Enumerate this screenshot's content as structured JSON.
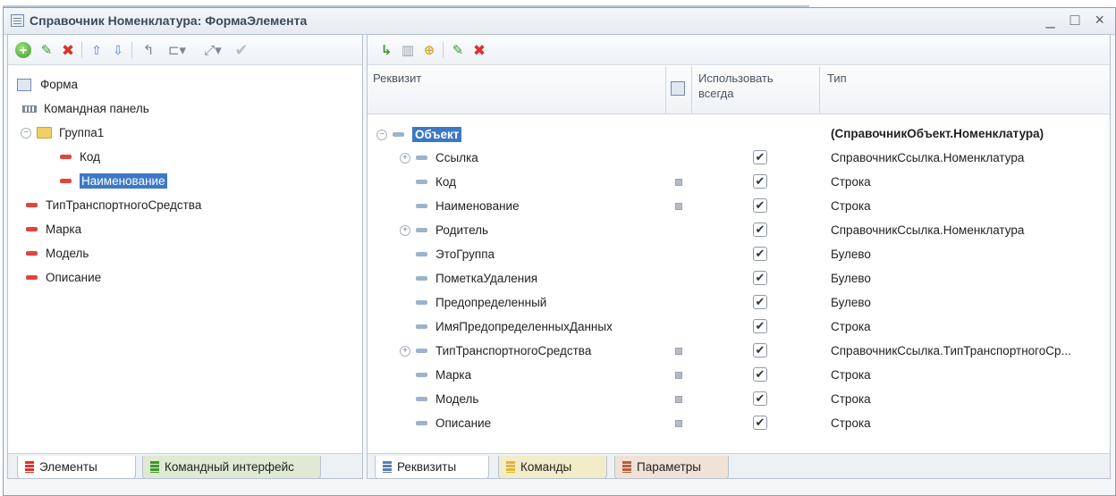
{
  "window": {
    "title": "Справочник Номенклатура: ФормаЭлемента",
    "controls": "_ □ ×"
  },
  "left": {
    "tree": [
      {
        "label": "Форма",
        "icon": "form-icon",
        "level": 0
      },
      {
        "label": "Командная панель",
        "icon": "command-panel-icon",
        "level": 0
      },
      {
        "label": "Группа1",
        "icon": "folder-icon",
        "level": 0,
        "expanded": true
      },
      {
        "label": "Код",
        "icon": "field-icon",
        "level": 1
      },
      {
        "label": "Наименование",
        "icon": "field-icon",
        "level": 1,
        "selected": true
      },
      {
        "label": "ТипТранспортногоСредства",
        "icon": "field-icon",
        "level": 0
      },
      {
        "label": "Марка",
        "icon": "field-icon",
        "level": 0
      },
      {
        "label": "Модель",
        "icon": "field-icon",
        "level": 0
      },
      {
        "label": "Описание",
        "icon": "field-icon",
        "level": 0
      }
    ],
    "tabs": [
      {
        "label": "Элементы",
        "active": true
      },
      {
        "label": "Командный интерфейс",
        "active": false
      }
    ]
  },
  "right": {
    "columns": {
      "attribute": "Реквизит",
      "use_always": "Использовать всегда",
      "type": "Тип"
    },
    "rows": [
      {
        "name": "Объект",
        "type": "(СправочникОбъект.Номенклатура)",
        "level": 0,
        "expander": "minus",
        "root": true
      },
      {
        "name": "Ссылка",
        "type": "СправочникСсылка.Номенклатура",
        "level": 1,
        "expander": "plus",
        "dot": false,
        "checked": true
      },
      {
        "name": "Код",
        "type": "Строка",
        "level": 1,
        "dot": true,
        "checked": true
      },
      {
        "name": "Наименование",
        "type": "Строка",
        "level": 1,
        "dot": true,
        "checked": true
      },
      {
        "name": "Родитель",
        "type": "СправочникСсылка.Номенклатура",
        "level": 1,
        "expander": "plus",
        "dot": false,
        "checked": true
      },
      {
        "name": "ЭтоГруппа",
        "type": "Булево",
        "level": 1,
        "dot": false,
        "checked": true
      },
      {
        "name": "ПометкаУдаления",
        "type": "Булево",
        "level": 1,
        "dot": false,
        "checked": true
      },
      {
        "name": "Предопределенный",
        "type": "Булево",
        "level": 1,
        "dot": false,
        "checked": true
      },
      {
        "name": "ИмяПредопределенныхДанных",
        "type": "Строка",
        "level": 1,
        "dot": false,
        "checked": true
      },
      {
        "name": "ТипТранспортногоСредства",
        "type": "СправочникСсылка.ТипТранспортногоСр...",
        "level": 1,
        "expander": "plus",
        "dot": true,
        "checked": true
      },
      {
        "name": "Марка",
        "type": "Строка",
        "level": 1,
        "dot": true,
        "checked": true
      },
      {
        "name": "Модель",
        "type": "Строка",
        "level": 1,
        "dot": true,
        "checked": true
      },
      {
        "name": "Описание",
        "type": "Строка",
        "level": 1,
        "dot": true,
        "checked": true
      }
    ],
    "tabs": [
      {
        "label": "Реквизиты",
        "active": true
      },
      {
        "label": "Команды",
        "active": false
      },
      {
        "label": "Параметры",
        "active": false
      }
    ]
  },
  "colors": {
    "selection": "#3d78c6",
    "tab_inactive": "#dfe9d3",
    "attribute_marker": "#e0473c"
  }
}
